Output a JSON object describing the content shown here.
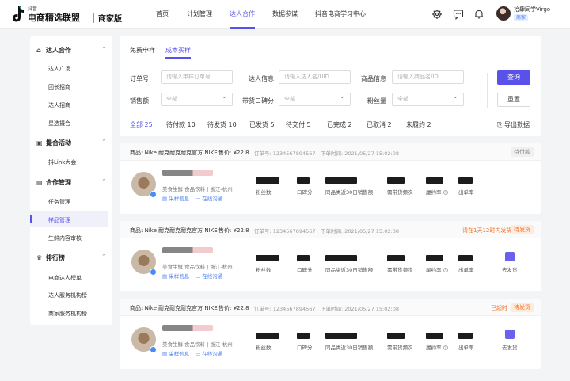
{
  "header": {
    "logo_small": "抖音",
    "logo_main": "电商精选联盟",
    "logo_tag": "商家版",
    "nav": [
      {
        "label": "首页"
      },
      {
        "label": "计划管理"
      },
      {
        "label": "达人合作"
      },
      {
        "label": "数据参谋"
      },
      {
        "label": "抖音电商学习中心"
      }
    ],
    "user_name": "拾肆同学Virgo",
    "user_badge": "商家",
    "icons": [
      "gear-icon",
      "message-icon",
      "bell-icon"
    ]
  },
  "sidebar": {
    "groups": [
      {
        "label": "达人合作",
        "icon": "home-icon",
        "items": [
          "达人广场",
          "团长招商",
          "达人招商",
          "星选撮合"
        ]
      },
      {
        "label": "撮合活动",
        "icon": "calendar-icon",
        "items": [
          "抖Link大会"
        ]
      },
      {
        "label": "合作管理",
        "icon": "doc-icon",
        "items": [
          "任务管理",
          "样品管理",
          "生鲜内容审核"
        ]
      },
      {
        "label": "排行榜",
        "icon": "trophy-icon",
        "items": [
          "电商达人榜单",
          "达人服务机构榜",
          "商家服务机构榜"
        ]
      }
    ],
    "active_item": "样品管理"
  },
  "main": {
    "tabs": [
      {
        "label": "免费申样"
      },
      {
        "label": "成本买样"
      }
    ],
    "filters": {
      "order_no_label": "订单号",
      "order_no_placeholder": "请输入申样订单号",
      "talent_label": "达人信息",
      "talent_placeholder": "请输入达人名/UID",
      "goods_label": "商品信息",
      "goods_placeholder": "请输入商品名/ID",
      "sales_label": "销售额",
      "sales_value": "全部",
      "score_label": "带货口碑分",
      "score_value": "全部",
      "fans_label": "粉丝量",
      "fans_value": "全部",
      "query_btn": "查询",
      "reset_btn": "重置"
    },
    "statuses": [
      {
        "label": "全部 25"
      },
      {
        "label": "待付款 10"
      },
      {
        "label": "待发货 10"
      },
      {
        "label": "已发货 5"
      },
      {
        "label": "待交付 5"
      },
      {
        "label": "已完成 2"
      },
      {
        "label": "已取消 2"
      },
      {
        "label": "未履约 2"
      }
    ],
    "export_label": "导出数据"
  },
  "orders": [
    {
      "goods": "商品: Nike 耐克耐克耐克官方 NIKE",
      "price": "售价: ¥22.8",
      "order_no": "订单号: 1234567894567",
      "time": "下单时间: 2021/05/27 15:02:08",
      "note": "",
      "badge": "待付款",
      "tags": "美食生鲜 食品饮料 | 浙江-杭州",
      "link1": "采样信息",
      "link2": "在线沟通",
      "metric_labels": [
        "粉丝数",
        "口碑分",
        "同品类近30日销售额",
        "需带货频次",
        "履约率",
        "出单率"
      ],
      "action": ""
    },
    {
      "goods": "商品: Nike 耐克耐克耐克官方 NIKE",
      "price": "售价: ¥22.8",
      "order_no": "订单号: 1234567894567",
      "time": "下单时间: 2021/05/27 15:02:08",
      "note": "请在1天12时内发货",
      "badge": "待发货",
      "tags": "美食生鲜 食品饮料 | 浙江-杭州",
      "link1": "采样信息",
      "link2": "在线沟通",
      "metric_labels": [
        "粉丝数",
        "口碑分",
        "同品类近30日销售额",
        "需带货频次",
        "履约率",
        "出单率"
      ],
      "action": "去发货"
    },
    {
      "goods": "商品: Nike 耐克耐克耐克官方 NIKE",
      "price": "售价: ¥22.8",
      "order_no": "订单号: 1234567894567",
      "time": "下单时间: 2021/05/27 15:02:08",
      "note": "已超时",
      "badge": "待发货",
      "tags": "美食生鲜 食品饮料 | 浙江-杭州",
      "link1": "采样信息",
      "link2": "在线沟通",
      "metric_labels": [
        "粉丝数",
        "口碑分",
        "同品类近30日销售额",
        "需带货频次",
        "履约率",
        "出单率"
      ],
      "action": "去发货"
    }
  ],
  "colors": {
    "accent": "#5a52e8",
    "link": "#4a7df0",
    "warning": "#f0732b"
  }
}
